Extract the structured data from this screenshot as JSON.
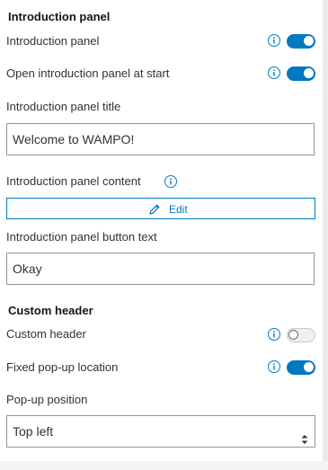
{
  "intro_section": {
    "heading": "Introduction panel",
    "toggle_intro_label": "Introduction panel",
    "toggle_intro_on": true,
    "toggle_open_label": "Open introduction panel at start",
    "toggle_open_on": true,
    "title_label": "Introduction panel title",
    "title_value": "Welcome to WAMPO!",
    "content_label": "Introduction panel content",
    "edit_button_label": "Edit",
    "button_text_label": "Introduction panel button text",
    "button_text_value": "Okay"
  },
  "header_section": {
    "heading": "Custom header",
    "toggle_header_label": "Custom header",
    "toggle_header_on": false,
    "toggle_fixed_label": "Fixed pop-up location",
    "toggle_fixed_on": true,
    "popup_position_label": "Pop-up position",
    "popup_position_value": "Top left"
  },
  "icons": {
    "info": "info-icon",
    "pencil": "pencil-icon",
    "caret": "up-down-caret-icon"
  },
  "colors": {
    "accent": "#0079c1",
    "text": "#323232",
    "border": "#959595"
  }
}
